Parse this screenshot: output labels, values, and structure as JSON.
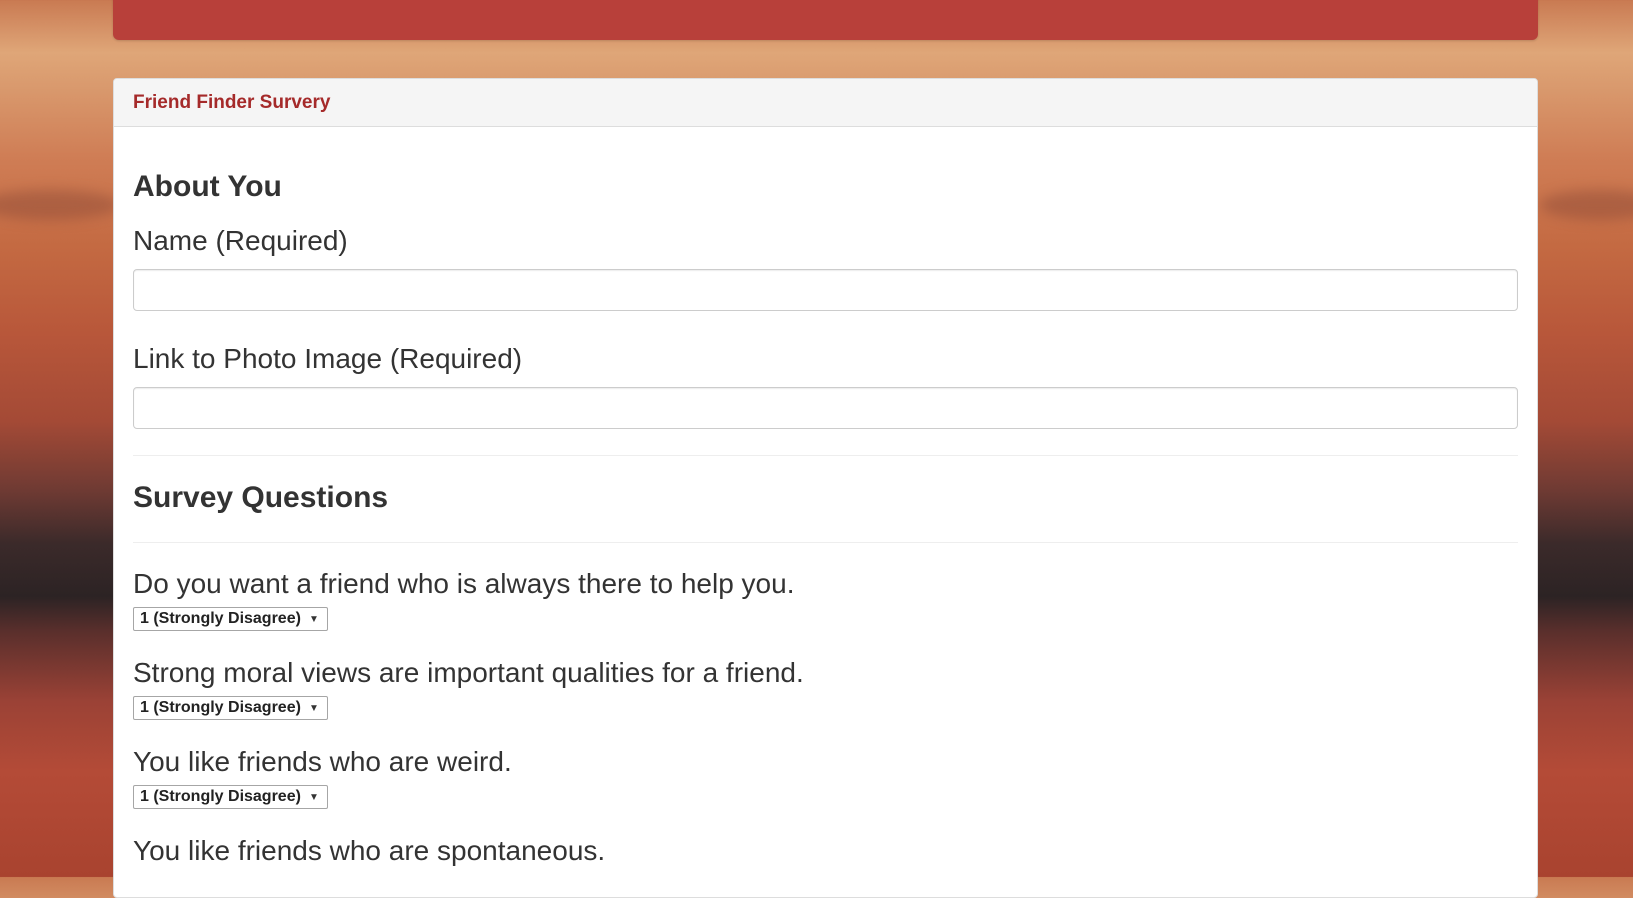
{
  "panel": {
    "title": "Friend Finder Survery"
  },
  "about": {
    "heading": "About You",
    "name_label": "Name (Required)",
    "name_value": "",
    "photo_label": "Link to Photo Image (Required)",
    "photo_value": ""
  },
  "survey": {
    "heading": "Survey Questions",
    "questions": [
      {
        "text": "Do you want a friend who is always there to help you.",
        "selected": "1 (Strongly Disagree)"
      },
      {
        "text": "Strong moral views are important qualities for a friend.",
        "selected": "1 (Strongly Disagree)"
      },
      {
        "text": "You like friends who are weird.",
        "selected": "1 (Strongly Disagree)"
      },
      {
        "text": "You like friends who are spontaneous.",
        "selected": ""
      }
    ]
  },
  "icons": {
    "select_caret": "chevron-down-icon"
  },
  "colors": {
    "top_bar": "#b8403a",
    "panel_title": "#a52a2a"
  }
}
